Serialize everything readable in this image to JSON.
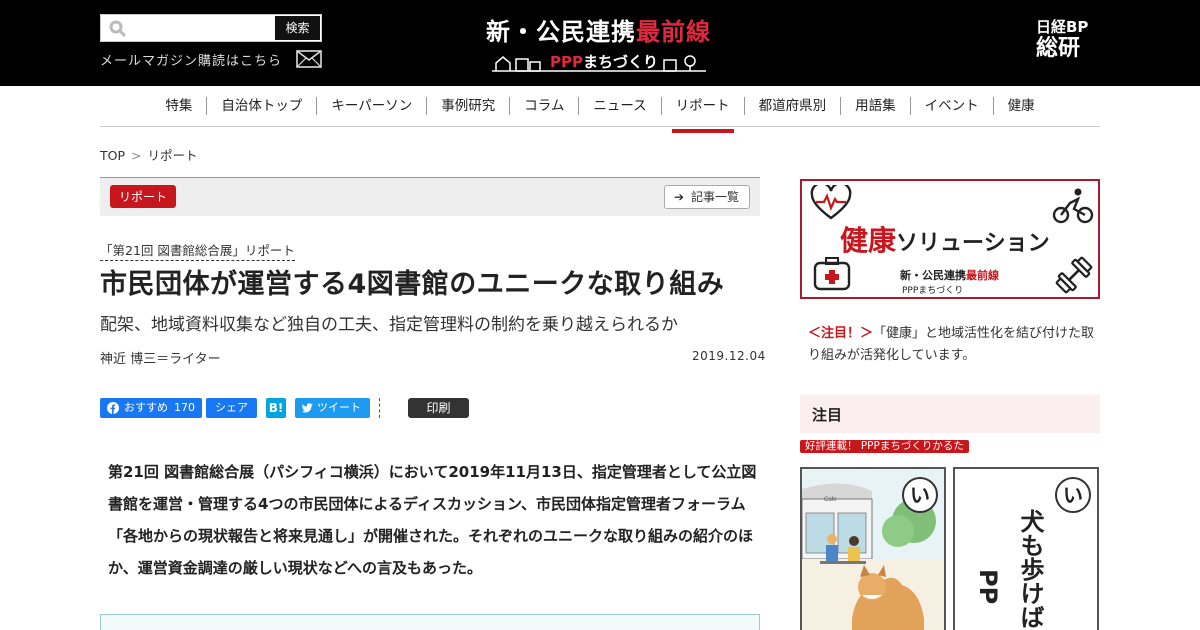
{
  "header": {
    "search_button": "検索",
    "search_placeholder": "",
    "mailmag_label": "メールマガジン購読はこちら",
    "logo_prefix": "新・公民連携",
    "logo_red": "最前線",
    "logo_sub_red": "PPP",
    "logo_sub_white": "まちづくり",
    "publisher_line1": "日経BP",
    "publisher_line2": "総研"
  },
  "nav": {
    "items": [
      "特集",
      "自治体トップ",
      "キーパーソン",
      "事例研究",
      "コラム",
      "ニュース",
      "リポート",
      "都道府県別",
      "用語集",
      "イベント",
      "健康"
    ],
    "active_index": 6
  },
  "breadcrumb": {
    "home": "TOP",
    "separator": ">",
    "current": "リポート"
  },
  "article": {
    "category": "リポート",
    "list_button": "記事一覧",
    "series": "「第21回 図書館総合展」リポート",
    "title": "市民団体が運営する4図書館のユニークな取り組み",
    "subtitle": "配架、地域資料収集など独自の工夫、指定管理料の制約を乗り越えられるか",
    "author": "神近 博三＝ライター",
    "date": "2019.12.04",
    "lead": "第21回 図書館総合展（パシフィコ横浜）において2019年11月13日、指定管理者として公立図書館を運営・管理する4つの市民団体によるディスカッション、市民団体指定管理者フォーラム「各地からの現状報告と将来見通し」が開催された。それぞれのユニークな取り組みの紹介のほか、運営資金調達の厳しい現状などへの言及もあった。"
  },
  "social": {
    "fb_like_label": "おすすめ",
    "fb_like_count": "170",
    "fb_share_label": "シェア",
    "hatena_label": "B!",
    "tweet_label": "ツイート",
    "print_label": "印刷"
  },
  "sidebar": {
    "ad": {
      "red_text": "健康",
      "black_text": "ソリューション",
      "logo_prefix": "新・公民連携",
      "logo_red": "最前線",
      "logo_sub": "PPPまちづくり"
    },
    "notice_prefix": "＜注目！＞",
    "notice_text": "「健康」と地域活性化を結び付けた取り組みが活発化しています。",
    "attention_title": "注目",
    "attention_tag": "好評連載！ PPPまちづくりかるた",
    "card1_kana": "い",
    "card2_kana": "い",
    "card2_text": "犬も歩けば",
    "card2_sub": "PP"
  },
  "colors": {
    "accent_red": "#c8161d",
    "header_bg": "#000000",
    "facebook": "#1877f2",
    "twitter": "#1d9bf0",
    "hatena": "#00a4de"
  }
}
